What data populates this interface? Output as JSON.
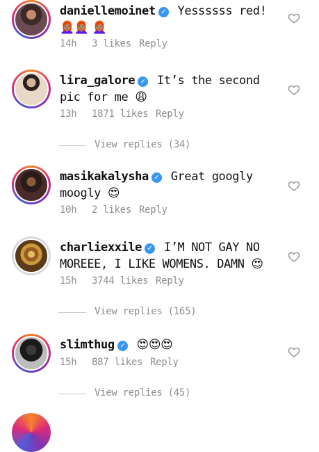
{
  "comments": [
    {
      "username": "daniellemoinet",
      "text": "Yessssss red!",
      "emoji": "👩🏽‍🦰👩🏽‍🦰 👩🏽‍🦰",
      "time": "14h",
      "likes": "3 likes",
      "reply": "Reply"
    },
    {
      "username": "lira_galore",
      "text": "It’s the second pic for me",
      "emoji": "😩",
      "time": "13h",
      "likes": "1871 likes",
      "reply": "Reply",
      "view_replies": "View replies (34)"
    },
    {
      "username": "masikakalysha",
      "text": "Great googly moogly",
      "emoji": "😍",
      "time": "10h",
      "likes": "2 likes",
      "reply": "Reply"
    },
    {
      "username": "charliexxile",
      "text": "I’M NOT GAY NO MOREEE, I LIKE WOMENS. DAMN",
      "emoji": "😍",
      "time": "15h",
      "likes": "3744 likes",
      "reply": "Reply",
      "view_replies": "View replies (165)"
    },
    {
      "username": "slimthug",
      "text": "",
      "emoji": "😍😍😍",
      "time": "15h",
      "likes": "887 likes",
      "reply": "Reply",
      "view_replies": "View replies (45)"
    }
  ],
  "icons": {
    "verified": "verified-badge-icon",
    "like": "heart-outline-icon"
  },
  "colors": {
    "verified": "#3897f0",
    "meta": "#8e8e8e",
    "ring": "#dd2a7b"
  }
}
